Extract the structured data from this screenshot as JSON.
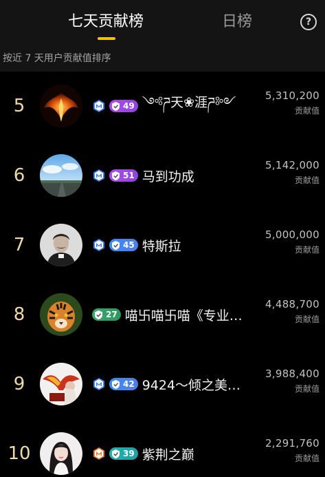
{
  "header": {
    "tab_7day": "七天贡献榜",
    "tab_day": "日榜",
    "help_symbol": "?",
    "subtitle": "按近 7 天用户贡献值排序"
  },
  "colors": {
    "accent": "#f5c400",
    "rank": "#f0d9a8",
    "background": "#000000"
  },
  "ranking": [
    {
      "rank": "5",
      "level": "49",
      "level_style": "purple",
      "has_m_badge": true,
      "m_badge_color": "blue",
      "name": "༺ཌ天❀涯ཌ༻",
      "score": "5,310,200",
      "score_label": "贡献值",
      "avatar_icon": "phoenix-avatar"
    },
    {
      "rank": "6",
      "level": "51",
      "level_style": "purple",
      "has_m_badge": true,
      "m_badge_color": "blue",
      "name": "马到功成",
      "score": "5,142,000",
      "score_label": "贡献值",
      "avatar_icon": "road-sky-avatar"
    },
    {
      "rank": "7",
      "level": "45",
      "level_style": "blue",
      "has_m_badge": true,
      "m_badge_color": "blue",
      "name": "特斯拉",
      "score": "5,000,000",
      "score_label": "贡献值",
      "avatar_icon": "portrait-avatar"
    },
    {
      "rank": "8",
      "level": "27",
      "level_style": "green",
      "has_m_badge": false,
      "m_badge_color": "",
      "name": "喵卐喵卐喵《专业…",
      "score": "4,488,700",
      "score_label": "贡献值",
      "avatar_icon": "tiger-avatar"
    },
    {
      "rank": "9",
      "level": "42",
      "level_style": "blue",
      "has_m_badge": true,
      "m_badge_color": "blue",
      "name": "9424～倾之美…",
      "score": "3,988,400",
      "score_label": "贡献值",
      "avatar_icon": "eagle-avatar"
    },
    {
      "rank": "10",
      "level": "39",
      "level_style": "teal",
      "has_m_badge": true,
      "m_badge_color": "orange",
      "name": "紫荆之巅",
      "score": "2,291,760",
      "score_label": "贡献值",
      "avatar_icon": "girl-avatar"
    }
  ]
}
